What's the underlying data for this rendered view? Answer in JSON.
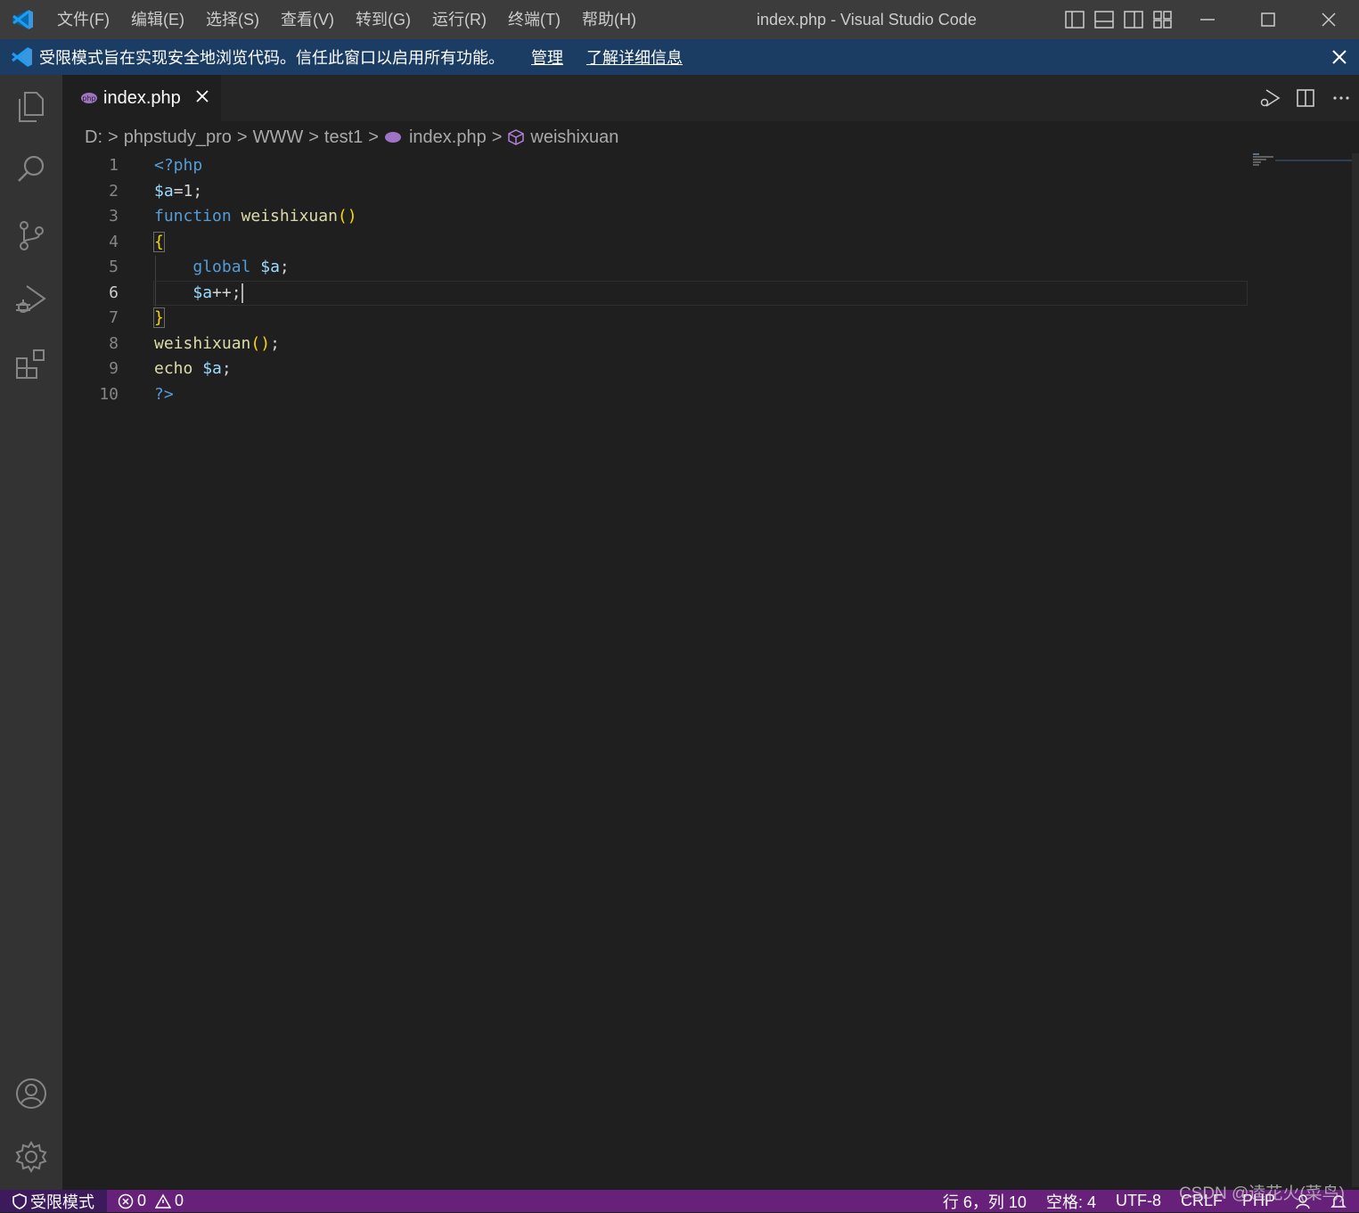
{
  "titlebar": {
    "menu": [
      "文件(F)",
      "编辑(E)",
      "选择(S)",
      "查看(V)",
      "转到(G)",
      "运行(R)",
      "终端(T)",
      "帮助(H)"
    ],
    "window_title": "index.php - Visual Studio Code"
  },
  "banner": {
    "message": "受限模式旨在实现安全地浏览代码。信任此窗口以启用所有功能。",
    "manage_link": "管理",
    "learn_link": "了解详细信息"
  },
  "tab": {
    "name": "index.php"
  },
  "breadcrumb": [
    "D:",
    "phpstudy_pro",
    "WWW",
    "test1",
    "index.php",
    "weishixuan"
  ],
  "code": {
    "line_numbers": [
      "1",
      "2",
      "3",
      "4",
      "5",
      "6",
      "7",
      "8",
      "9",
      "10"
    ],
    "active_line": 6
  },
  "status": {
    "restricted_mode": "受限模式",
    "errors": "0",
    "warnings": "0",
    "position": "行 6，列 10",
    "spaces": "空格: 4",
    "encoding": "UTF-8",
    "eol": "CRLF",
    "language": "PHP"
  },
  "watermark": "CSDN @逵花火(菜鸟)",
  "colors": {
    "accent": "#0078d4",
    "status_bar": "#68217a",
    "banner": "#1b3d64"
  }
}
